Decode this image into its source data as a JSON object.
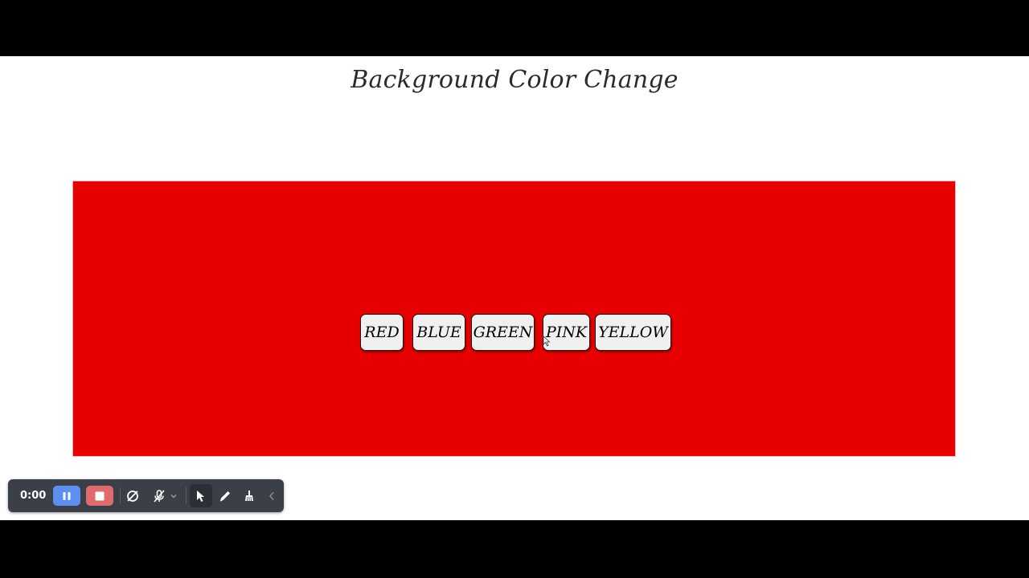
{
  "page": {
    "title": "Background Color Change",
    "current_background": "#e60000"
  },
  "buttons": [
    {
      "label": "RED"
    },
    {
      "label": "BLUE"
    },
    {
      "label": "GREEN"
    },
    {
      "label": "PINK"
    },
    {
      "label": "YELLOW"
    }
  ],
  "recorder_toolbar": {
    "timer": "0:00",
    "icons": [
      "pause-icon",
      "stop-icon",
      "camera-off-icon",
      "mic-off-icon",
      "chevron-down-icon",
      "pointer-icon",
      "pen-icon",
      "broom-icon",
      "chevron-left-icon"
    ],
    "pause_color": "#5d8ff3",
    "stop_color": "#e06b6e"
  }
}
